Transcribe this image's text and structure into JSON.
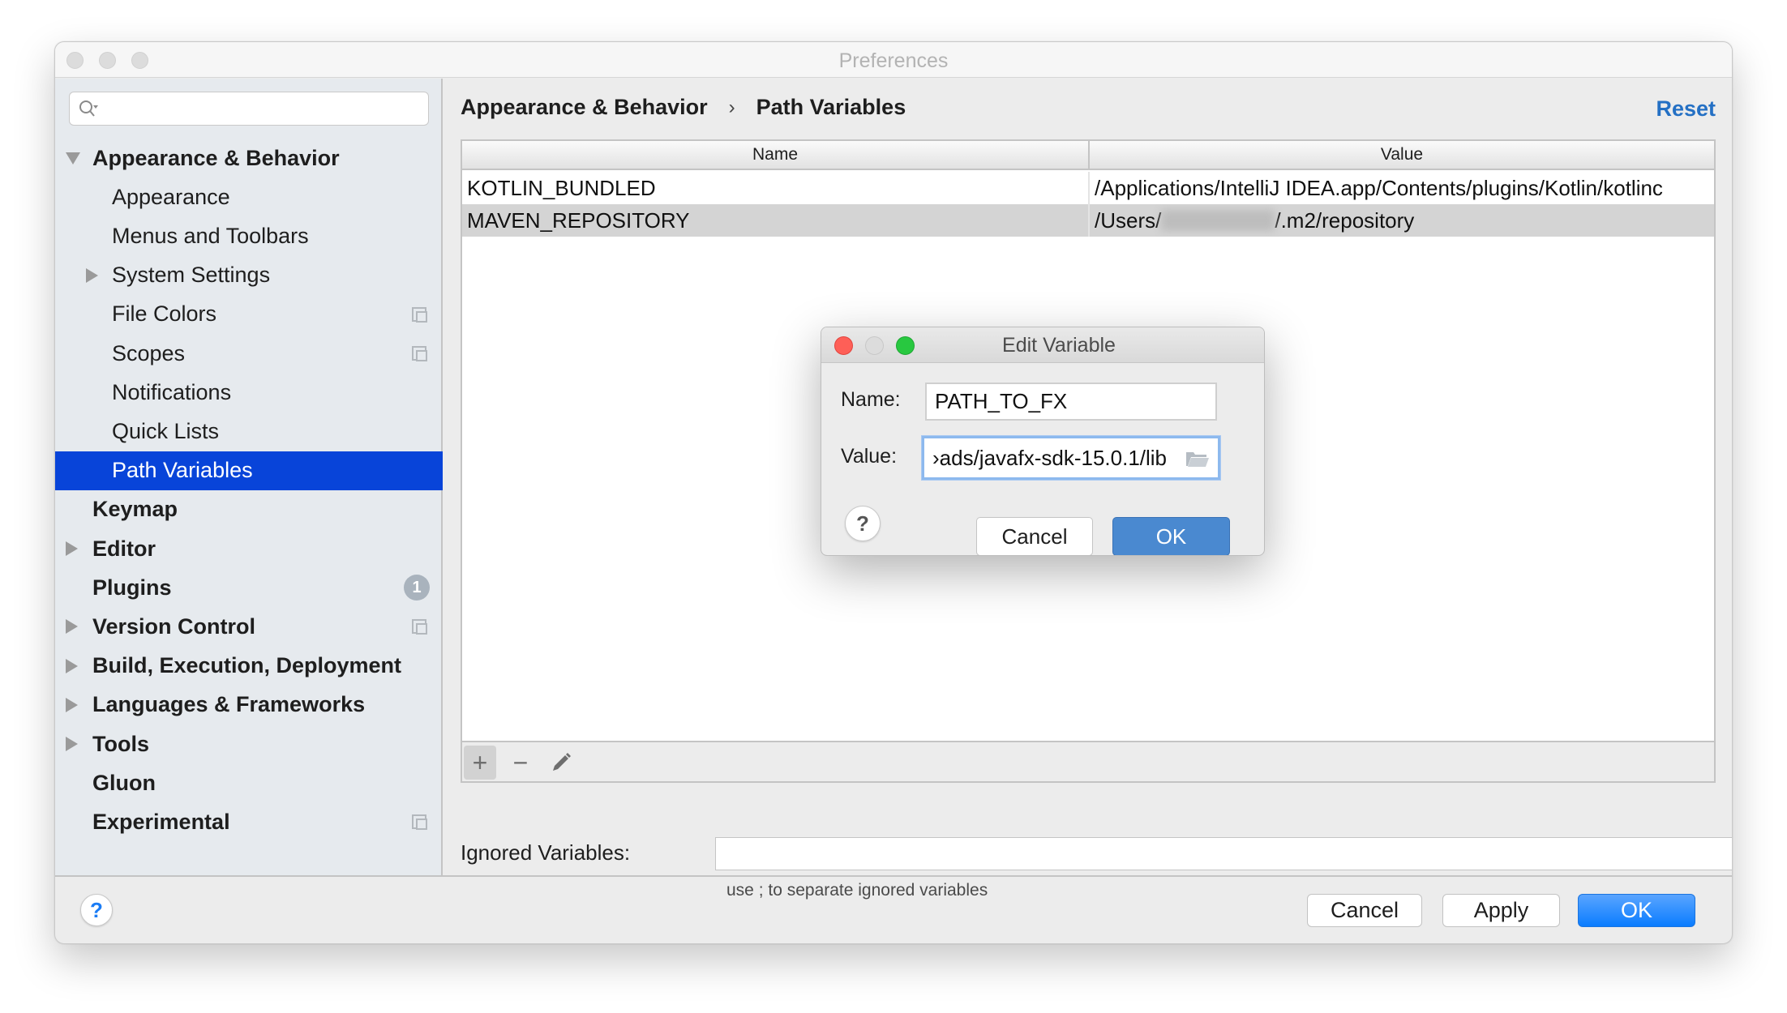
{
  "window": {
    "title": "Preferences"
  },
  "search": {
    "placeholder": "",
    "value": ""
  },
  "sidebar": {
    "items": [
      {
        "label": "Appearance & Behavior",
        "bold": true,
        "expand": "expanded",
        "level": 0
      },
      {
        "label": "Appearance",
        "bold": false,
        "expand": "none",
        "level": 1
      },
      {
        "label": "Menus and Toolbars",
        "bold": false,
        "expand": "none",
        "level": 1
      },
      {
        "label": "System Settings",
        "bold": false,
        "expand": "collapsed",
        "level": 1
      },
      {
        "label": "File Colors",
        "bold": false,
        "expand": "none",
        "level": 1,
        "project_icon": true
      },
      {
        "label": "Scopes",
        "bold": false,
        "expand": "none",
        "level": 1,
        "project_icon": true
      },
      {
        "label": "Notifications",
        "bold": false,
        "expand": "none",
        "level": 1
      },
      {
        "label": "Quick Lists",
        "bold": false,
        "expand": "none",
        "level": 1
      },
      {
        "label": "Path Variables",
        "bold": false,
        "expand": "none",
        "level": 1,
        "selected": true
      },
      {
        "label": "Keymap",
        "bold": true,
        "expand": "none",
        "level": 0
      },
      {
        "label": "Editor",
        "bold": true,
        "expand": "collapsed",
        "level": 0
      },
      {
        "label": "Plugins",
        "bold": true,
        "expand": "none",
        "level": 0,
        "badge": "1"
      },
      {
        "label": "Version Control",
        "bold": true,
        "expand": "collapsed",
        "level": 0,
        "project_icon": true
      },
      {
        "label": "Build, Execution, Deployment",
        "bold": true,
        "expand": "collapsed",
        "level": 0
      },
      {
        "label": "Languages & Frameworks",
        "bold": true,
        "expand": "collapsed",
        "level": 0
      },
      {
        "label": "Tools",
        "bold": true,
        "expand": "collapsed",
        "level": 0
      },
      {
        "label": "Gluon",
        "bold": true,
        "expand": "none",
        "level": 0
      },
      {
        "label": "Experimental",
        "bold": true,
        "expand": "none",
        "level": 0,
        "project_icon": true
      }
    ]
  },
  "header": {
    "breadcrumb": [
      "Appearance & Behavior",
      "Path Variables"
    ],
    "separator": "›",
    "reset_label": "Reset"
  },
  "table": {
    "columns": [
      "Name",
      "Value"
    ],
    "rows": [
      {
        "name": "KOTLIN_BUNDLED",
        "value": "/Applications/IntelliJ IDEA.app/Contents/plugins/Kotlin/kotlinc",
        "selected": false
      },
      {
        "name": "MAVEN_REPOSITORY",
        "value_prefix": "/Users/",
        "value_suffix": "/.m2/repository",
        "value_redacted": true,
        "selected": true
      }
    ],
    "toolbar": {
      "add": "+",
      "remove": "−",
      "edit_icon": "pencil-icon"
    }
  },
  "ignored": {
    "label": "Ignored Variables:",
    "value": "",
    "hint": "use ; to separate ignored variables"
  },
  "footer": {
    "help": "?",
    "cancel": "Cancel",
    "apply": "Apply",
    "ok": "OK"
  },
  "dialog": {
    "title": "Edit Variable",
    "name_label": "Name:",
    "name_value": "PATH_TO_FX",
    "value_label": "Value:",
    "value_value": "›ads/javafx-sdk-15.0.1/lib",
    "help": "?",
    "cancel": "Cancel",
    "ok": "OK",
    "colors": {
      "close": "#fe5f57",
      "minimize": "#dcdcdc",
      "zoom": "#28c840",
      "ok": "#4a89d0"
    }
  },
  "colors": {
    "selection": "#0844d9",
    "link": "#2470c4",
    "primary_button": "#0a7cff"
  }
}
